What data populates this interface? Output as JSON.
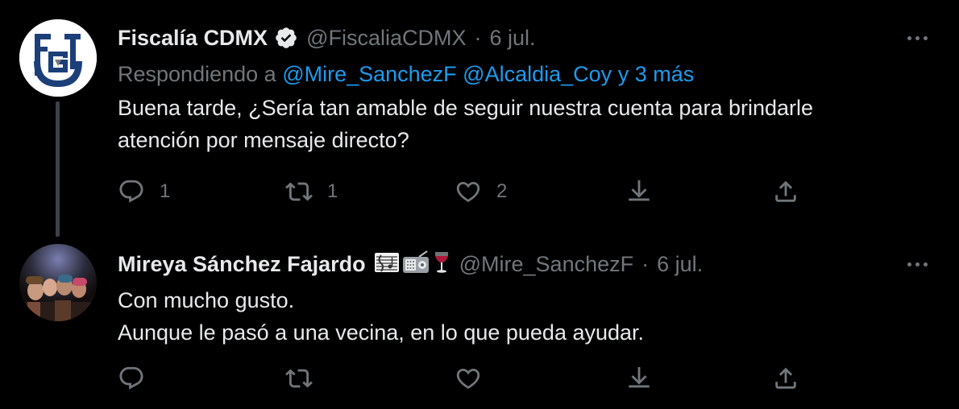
{
  "tweets": [
    {
      "author_name": "Fiscalía CDMX",
      "verified": true,
      "handle": "@FiscaliaCDMX",
      "separator": "·",
      "time": "6 jul.",
      "replying_prefix": "Respondiendo a",
      "replying_mentions": "@Mire_SanchezF @Alcaldia_Coy",
      "replying_more": "y 3 más",
      "text_lines": [
        "Buena tarde, ¿Sería tan amable de seguir nuestra cuenta para brindarle",
        "atención por mensaje directo?"
      ],
      "reply_count": "1",
      "retweet_count": "1",
      "like_count": "2",
      "logo": "FGJ"
    },
    {
      "author_name": "Mireya Sánchez Fajardo",
      "name_emojis": [
        "🎼",
        "📻",
        "🍷"
      ],
      "handle": "@Mire_SanchezF",
      "separator": "·",
      "time": "6 jul.",
      "text_lines": [
        "Con mucho gusto.",
        "Aunque le pasó a una vecina, en lo que pueda ayudar."
      ],
      "reply_count": "",
      "retweet_count": "",
      "like_count": ""
    }
  ],
  "icons": {
    "more": "more-dots-icon",
    "reply": "reply-bubble-icon",
    "retweet": "retweet-icon",
    "like": "heart-icon",
    "download": "download-icon",
    "share": "share-icon",
    "verified": "verified-badge-icon"
  },
  "colors": {
    "background": "#000000",
    "text": "#e7e9ea",
    "muted": "#71767b",
    "link": "#1d9bf0",
    "logo_blue": "#1c3f7a"
  }
}
